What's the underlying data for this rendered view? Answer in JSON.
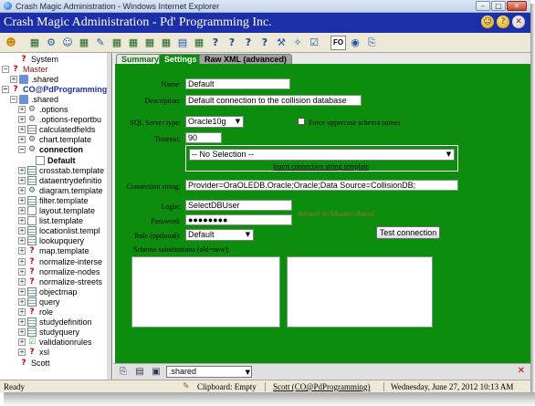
{
  "window": {
    "title": "Crash Magic Administration - Windows Internet Explorer",
    "min": "–",
    "max": "□",
    "close": "✕"
  },
  "header": {
    "title": "Crash Magic Administration - Pd' Programming Inc.",
    "icon_labels": [
      "☺",
      "?",
      "✕"
    ]
  },
  "toolbar": {
    "help_glyph": "?",
    "fo_label": "FO"
  },
  "tree": {
    "items": [
      {
        "label": "System",
        "icon": "question-icon",
        "exp": "",
        "indent": 1
      },
      {
        "label": "Master",
        "icon": "question-icon",
        "exp": "−",
        "indent": 0
      },
      {
        "label": ".shared",
        "icon": "folder-icon",
        "exp": "+",
        "indent": 1
      },
      {
        "label": "CO@PdProgramming",
        "icon": "question-icon",
        "exp": "−",
        "indent": 0
      },
      {
        "label": ".shared",
        "icon": "folder-icon",
        "exp": "−",
        "indent": 1
      },
      {
        "label": ".options",
        "icon": "gear-icon",
        "exp": "+",
        "indent": 2
      },
      {
        "label": ".options-reportbu",
        "icon": "gear-icon",
        "exp": "+",
        "indent": 2
      },
      {
        "label": "calculatedfields",
        "icon": "grid-icon",
        "exp": "+",
        "indent": 2
      },
      {
        "label": "chart.template",
        "icon": "gear-icon",
        "exp": "+",
        "indent": 2
      },
      {
        "label": "connection",
        "icon": "connection-icon",
        "exp": "−",
        "indent": 2
      },
      {
        "label": "Default",
        "icon": "doc-icon",
        "exp": "",
        "indent": 3
      },
      {
        "label": "crosstab.template",
        "icon": "grid-icon",
        "exp": "+",
        "indent": 2
      },
      {
        "label": "dataentrydefinitio",
        "icon": "grid-icon",
        "exp": "+",
        "indent": 2
      },
      {
        "label": "diagram.template",
        "icon": "gear-icon",
        "exp": "+",
        "indent": 2
      },
      {
        "label": "filter.template",
        "icon": "grid-icon",
        "exp": "+",
        "indent": 2
      },
      {
        "label": "layout.template",
        "icon": "doc-icon",
        "exp": "+",
        "indent": 2
      },
      {
        "label": "list.template",
        "icon": "doc-icon",
        "exp": "+",
        "indent": 2
      },
      {
        "label": "locationlist.templ",
        "icon": "grid-icon",
        "exp": "+",
        "indent": 2
      },
      {
        "label": "lookupquery",
        "icon": "grid-icon",
        "exp": "+",
        "indent": 2
      },
      {
        "label": "map.template",
        "icon": "question-icon",
        "exp": "+",
        "indent": 2
      },
      {
        "label": "normalize-interse",
        "icon": "question-icon",
        "exp": "+",
        "indent": 2
      },
      {
        "label": "normalize-nodes",
        "icon": "question-icon",
        "exp": "+",
        "indent": 2
      },
      {
        "label": "normalize-streets",
        "icon": "question-icon",
        "exp": "+",
        "indent": 2
      },
      {
        "label": "objectmap",
        "icon": "grid-icon",
        "exp": "+",
        "indent": 2
      },
      {
        "label": "query",
        "icon": "grid-icon",
        "exp": "+",
        "indent": 2
      },
      {
        "label": "role",
        "icon": "question-icon",
        "exp": "+",
        "indent": 2
      },
      {
        "label": "studydefinition",
        "icon": "grid-icon",
        "exp": "+",
        "indent": 2
      },
      {
        "label": "studyquery",
        "icon": "grid-icon",
        "exp": "+",
        "indent": 2
      },
      {
        "label": "validationrules",
        "icon": "check-icon",
        "exp": "+",
        "indent": 2
      },
      {
        "label": "xsl",
        "icon": "question-icon",
        "exp": "+",
        "indent": 2
      },
      {
        "label": "Scott",
        "icon": "question-icon",
        "exp": "",
        "indent": 1
      }
    ]
  },
  "tabs": {
    "summary": "Summary",
    "settings": "Settings",
    "raw": "Raw XML (advanced)"
  },
  "form": {
    "name_label": "Name:",
    "name_value": "Default",
    "description_label": "Description:",
    "description_value": "Default connection to the collision database",
    "sql_type_label": "SQL Server type:",
    "sql_type_value": "Oracle10g",
    "force_upper_label": "Force uppercase schema names",
    "timeout_label": "Timeout:",
    "timeout_value": "90",
    "conn_select_value": "-- No Selection --",
    "insert_link": "Insert connection string template",
    "conn_string_label": "Connection string:",
    "conn_string_value": "Provider=OraOLEDB.Oracle;Oracle;Data Source=CollisionDB;",
    "login_label": "Login:",
    "login_value": "SelectDBUser",
    "password_label": "Password:",
    "password_value": "●●●●●●●●",
    "defined_in_text": "defined in /Master/.shared",
    "role_label": "Role (optional):",
    "role_value": "Default",
    "test_button": "Test connection",
    "schema_label": "Schema substitutions (old=new):"
  },
  "bottom": {
    "select_value": ".shared",
    "close": "✕"
  },
  "status": {
    "left": "Ready",
    "clipboard": "Clipboard: Empty",
    "user": "Scott (CO@PdProgramming)",
    "datetime": "Wednesday, June 27, 2012 10:13 AM"
  }
}
